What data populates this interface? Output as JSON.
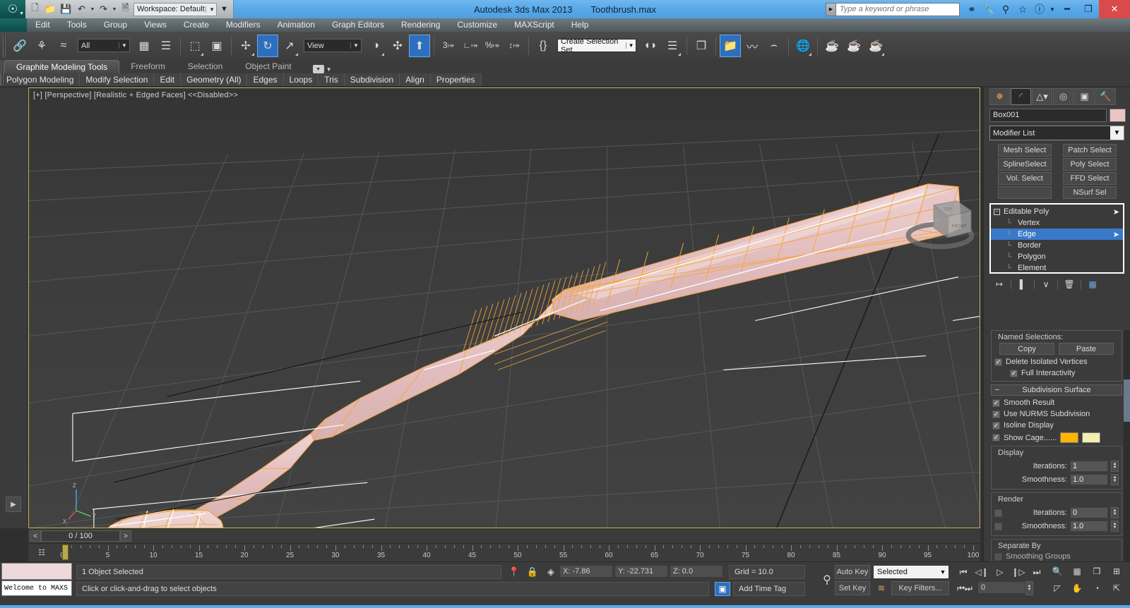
{
  "titlebar": {
    "app_title": "Autodesk 3ds Max  2013",
    "file_name": "Toothbrush.max",
    "logo": "3dsmax-logo-icon",
    "quick_access": [
      {
        "name": "new-file-icon",
        "glyph": "❐"
      },
      {
        "name": "open-file-icon",
        "glyph": "📂"
      },
      {
        "name": "save-file-icon",
        "glyph": "💾"
      },
      {
        "name": "undo-icon",
        "glyph": "↶"
      },
      {
        "name": "redo-icon",
        "glyph": "↷"
      },
      {
        "name": "set-project-folder-icon",
        "glyph": "❑"
      }
    ],
    "workspace_label": "Workspace: Default",
    "search_placeholder": "Type a keyword or phrase",
    "help_icons": [
      {
        "name": "search-binoculars-icon",
        "glyph": "⚭"
      },
      {
        "name": "wrench-icon",
        "glyph": "🔧"
      },
      {
        "name": "satellite-dish-icon",
        "glyph": "፠"
      },
      {
        "name": "favorites-star-icon",
        "glyph": "☆"
      },
      {
        "name": "help-icon",
        "glyph": "?"
      }
    ],
    "window_buttons": [
      {
        "name": "minimize-button",
        "glyph": "—"
      },
      {
        "name": "restore-button",
        "glyph": "❐"
      },
      {
        "name": "close-button",
        "glyph": "✕"
      }
    ]
  },
  "menubar": {
    "items": [
      "Edit",
      "Tools",
      "Group",
      "Views",
      "Create",
      "Modifiers",
      "Animation",
      "Graph Editors",
      "Rendering",
      "Customize",
      "MAXScript",
      "Help"
    ]
  },
  "main_toolbar": {
    "selection_filter": "All",
    "reference_coord_system": "View",
    "named_selection_sets": "Create Selection Set",
    "buttons": [
      {
        "name": "select-and-link-icon",
        "glyph": "🔗",
        "active": false
      },
      {
        "name": "unlink-selection-icon",
        "glyph": "✂",
        "active": false
      },
      {
        "name": "bind-to-space-warp-icon",
        "glyph": "≈",
        "active": false
      },
      {
        "name": "select-object-icon",
        "glyph": "◱",
        "active": false
      },
      {
        "name": "select-by-name-icon",
        "glyph": "☰",
        "active": false
      },
      {
        "name": "rectangular-selection-region-icon",
        "glyph": "⬚",
        "active": false
      },
      {
        "name": "window-crossing-icon",
        "glyph": "▣",
        "active": false
      },
      {
        "name": "select-and-move-icon",
        "glyph": "✚",
        "active": false
      },
      {
        "name": "select-and-rotate-icon",
        "glyph": "↻",
        "active": true
      },
      {
        "name": "select-and-scale-icon",
        "glyph": "⤡",
        "active": false
      },
      {
        "name": "use-center-flyout-icon",
        "glyph": "◑",
        "active": false
      },
      {
        "name": "select-and-manipulate-icon",
        "glyph": "✣",
        "active": false
      },
      {
        "name": "keyboard-shortcut-override-icon",
        "glyph": "⬆",
        "active": true
      },
      {
        "name": "snaps-toggle-icon",
        "glyph": "3",
        "active": false
      },
      {
        "name": "angle-snap-toggle-icon",
        "glyph": "∠",
        "active": false
      },
      {
        "name": "percent-snap-toggle-icon",
        "glyph": "%",
        "active": false
      },
      {
        "name": "spinner-snap-toggle-icon",
        "glyph": "↕",
        "active": false
      },
      {
        "name": "edit-named-selection-sets-icon",
        "glyph": "{}",
        "active": false
      },
      {
        "name": "mirror-icon",
        "glyph": "◐",
        "active": false
      },
      {
        "name": "align-flyout-icon",
        "glyph": "≡",
        "active": false
      },
      {
        "name": "layer-manager-icon",
        "glyph": "❐",
        "active": false
      },
      {
        "name": "toggle-scene-explorer-icon",
        "glyph": "📁",
        "active": true
      },
      {
        "name": "curve-editor-icon",
        "glyph": "〰",
        "active": false
      },
      {
        "name": "schematic-view-icon",
        "glyph": "⤓",
        "active": false
      },
      {
        "name": "material-editor-icon",
        "glyph": "◎",
        "active": false
      },
      {
        "name": "render-setup-icon",
        "glyph": "⚒",
        "active": false
      },
      {
        "name": "rendered-frame-window-icon",
        "glyph": "◔",
        "active": false
      },
      {
        "name": "render-production-icon",
        "glyph": "☕",
        "active": false
      }
    ]
  },
  "ribbon": {
    "tabs": [
      {
        "label": "Graphite Modeling Tools",
        "active": true
      },
      {
        "label": "Freeform",
        "active": false
      },
      {
        "label": "Selection",
        "active": false
      },
      {
        "label": "Object Paint",
        "active": false
      }
    ],
    "panels": [
      "Polygon Modeling",
      "Modify Selection",
      "Edit",
      "Geometry (All)",
      "Edges",
      "Loops",
      "Tris",
      "Subdivision",
      "Align",
      "Properties"
    ]
  },
  "viewport": {
    "label": "[+] [Perspective] [Realistic + Edged Faces]  <<Disabled>>",
    "grid_color": "#5a5a5a",
    "background_color": "#3a3a3a",
    "object_fill": "#e2bfc0",
    "cage_color": "#f5a63a",
    "selection_color": "#ffffff",
    "axis_labels": [
      "Z",
      "Y",
      "X"
    ],
    "view_cube_faces": [
      "TOP",
      "FRONT"
    ]
  },
  "command_panel": {
    "tabs": [
      {
        "name": "create-tab",
        "glyph": "☀",
        "active": false
      },
      {
        "name": "modify-tab",
        "glyph": "◜",
        "active": true
      },
      {
        "name": "hierarchy-tab",
        "glyph": "♒",
        "active": false
      },
      {
        "name": "motion-tab",
        "glyph": "◎",
        "active": false
      },
      {
        "name": "display-tab",
        "glyph": "▣",
        "active": false
      },
      {
        "name": "utilities-tab",
        "glyph": "🔨",
        "active": false
      }
    ],
    "object_name": "Box001",
    "object_color": "#e9c4c4",
    "modifier_list_label": "Modifier List",
    "modifier_buttons": [
      "Mesh Select",
      "Patch Select",
      "SplineSelect",
      "Poly Select",
      "Vol. Select",
      "FFD Select",
      "",
      "NSurf Sel"
    ],
    "stack": [
      {
        "label": "Editable Poly",
        "level": 0,
        "selected": false,
        "has_toggle": true
      },
      {
        "label": "Vertex",
        "level": 1,
        "selected": false,
        "has_toggle": false
      },
      {
        "label": "Edge",
        "level": 1,
        "selected": true,
        "has_toggle": true
      },
      {
        "label": "Border",
        "level": 1,
        "selected": false,
        "has_toggle": false
      },
      {
        "label": "Polygon",
        "level": 1,
        "selected": false,
        "has_toggle": false
      },
      {
        "label": "Element",
        "level": 1,
        "selected": false,
        "has_toggle": false
      }
    ],
    "stack_tools": [
      {
        "name": "pin-stack-icon",
        "glyph": "↦"
      },
      {
        "name": "show-end-result-icon",
        "glyph": "❗"
      },
      {
        "name": "make-unique-icon",
        "glyph": "∨"
      },
      {
        "name": "remove-modifier-icon",
        "glyph": "🗑"
      },
      {
        "name": "configure-modifier-sets-icon",
        "glyph": "▦"
      }
    ],
    "named_selections": {
      "legend": "Named Selections:",
      "copy_label": "Copy",
      "paste_label": "Paste",
      "delete_isolated_vertices": {
        "label": "Delete Isolated Vertices",
        "checked": true
      },
      "full_interactivity": {
        "label": "Full Interactivity",
        "checked": true
      }
    },
    "subdivision_surface": {
      "title": "Subdivision Surface",
      "smooth_result": {
        "label": "Smooth Result",
        "checked": true
      },
      "use_nurms": {
        "label": "Use NURMS Subdivision",
        "checked": true
      },
      "isoline_display": {
        "label": "Isoline Display",
        "checked": true
      },
      "show_cage": {
        "label": "Show Cage......",
        "checked": true,
        "color1": "#ffb400",
        "color2": "#f2efb0"
      },
      "display_group": "Display",
      "display_iterations": {
        "label": "Iterations:",
        "value": "1"
      },
      "display_smoothness": {
        "label": "Smoothness:",
        "value": "1.0"
      },
      "render_group": "Render",
      "render_iterations": {
        "label": "Iterations:",
        "value": "0",
        "checked": false
      },
      "render_smoothness": {
        "label": "Smoothness:",
        "value": "1.0",
        "checked": false
      },
      "separate_by": "Separate By",
      "smoothing_groups": "Smoothing Groups"
    }
  },
  "timebar": {
    "prev_frame": "<",
    "next_frame": ">",
    "frame_display": "0 / 100",
    "ruler_labels": [
      "0",
      "5",
      "10",
      "15",
      "20",
      "25",
      "30",
      "35",
      "40",
      "45",
      "50",
      "55",
      "60",
      "65",
      "70",
      "75",
      "80",
      "85",
      "90",
      "95",
      "100"
    ],
    "ruler_min": 0,
    "ruler_max": 100,
    "current_frame": 0
  },
  "statusbar": {
    "material_swatch_color": "#eed9da",
    "maxscript_listener": "Welcome to MAXS",
    "selection_status": "1 Object Selected",
    "prompt": "Click or click-and-drag to select objects",
    "coords": {
      "x": {
        "label": "X:",
        "value": "-7.86"
      },
      "y": {
        "label": "Y:",
        "value": "-22.731"
      },
      "z": {
        "label": "Z:",
        "value": "0.0"
      }
    },
    "grid": "Grid = 10.0",
    "add_time_tag": "Add Time Tag",
    "lock_icon": "lock-selection-icon",
    "absolute_mode_icon": "absolute-relative-transform-icon",
    "auto_key": "Auto Key",
    "set_key": "Set Key",
    "key_mode": "Selected",
    "key_filters": "Key Filters...",
    "key_frame_value": "0",
    "playback_buttons": [
      {
        "name": "goto-start-button",
        "glyph": "⏮"
      },
      {
        "name": "previous-frame-button",
        "glyph": "◁"
      },
      {
        "name": "play-animation-button",
        "glyph": "▷"
      },
      {
        "name": "next-frame-button",
        "glyph": "▷"
      },
      {
        "name": "goto-end-button",
        "glyph": "⏭"
      },
      {
        "name": "key-mode-toggle-button",
        "glyph": "⏭"
      }
    ],
    "nav_buttons": [
      {
        "name": "zoom-icon",
        "glyph": "🔍"
      },
      {
        "name": "zoom-all-icon",
        "glyph": "▦"
      },
      {
        "name": "zoom-extents-icon",
        "glyph": "❑"
      },
      {
        "name": "zoom-extents-all-icon",
        "glyph": "⊞"
      },
      {
        "name": "field-of-view-icon",
        "glyph": "◰"
      },
      {
        "name": "pan-view-icon",
        "glyph": "✋"
      },
      {
        "name": "orbit-icon",
        "glyph": "◔"
      },
      {
        "name": "maximize-viewport-toggle-icon",
        "glyph": "⤡"
      }
    ]
  }
}
